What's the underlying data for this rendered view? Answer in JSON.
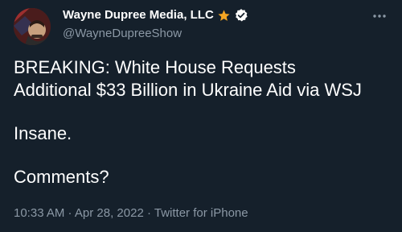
{
  "author": {
    "display_name": "Wayne Dupree Media, LLC",
    "handle": "@WayneDupreeShow",
    "badge_icons": [
      "star-icon",
      "verified-icon"
    ],
    "star_color": "#f5a623",
    "verified_color": "#ffffff"
  },
  "tweet": {
    "line1": "BREAKING: White House Requests",
    "line2": "Additional $33 Billion in Ukraine Aid via WSJ",
    "line3": "Insane.",
    "line4": "Comments?"
  },
  "meta": {
    "time": "10:33 AM",
    "separator1": " · ",
    "date": "Apr 28, 2022",
    "separator2": " · ",
    "source": "Twitter for iPhone"
  },
  "colors": {
    "background": "#15202b",
    "text": "#ffffff",
    "secondary": "#8b98a5"
  }
}
